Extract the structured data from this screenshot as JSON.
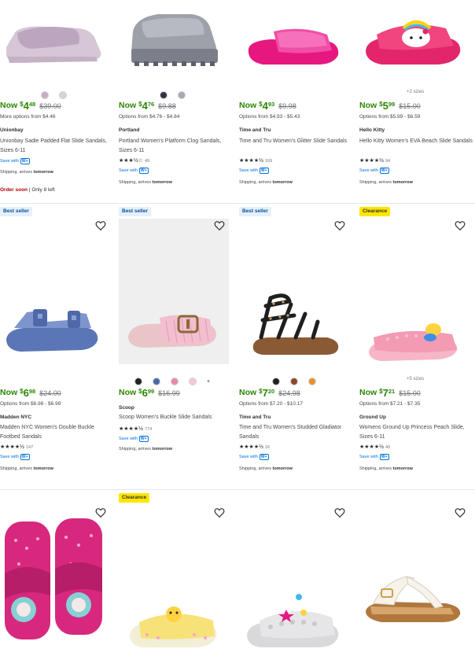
{
  "row1": [
    {
      "swatch_colors": [
        "#c9aec2",
        "#d5d5d5"
      ],
      "sizes_note": "",
      "now": "Now",
      "dollar": "$",
      "whole": "4",
      "cents": "48",
      "was": "$39.00",
      "options": "More options from $4.46",
      "brand": "Unionbay",
      "title": "Unionbay Sadie Padded Flat Slide Sandals, Sizes 6-11",
      "rating_stars": "",
      "rating_count": "",
      "save_with": "Save with",
      "wplus": "W+",
      "shipping": "Shipping, arrives",
      "shipping_day": "tomorrow",
      "urgency_red": "Order soon",
      "urgency_rest": " | Only 8 left"
    },
    {
      "swatch_colors": [
        "#2f3540",
        "#a5a9b6"
      ],
      "sizes_note": "",
      "now": "Now",
      "dollar": "$",
      "whole": "4",
      "cents": "76",
      "was": "$9.88",
      "options": "Options from $4.76 - $4.84",
      "brand": "Portland",
      "title": "Portland Women's Platform Clog Sandals, Sizes 6-11",
      "rating_stars": "★★★½☆",
      "rating_count": "49",
      "save_with": "Save with",
      "wplus": "W+",
      "shipping": "Shipping, arrives",
      "shipping_day": "tomorrow"
    },
    {
      "swatch_colors": [],
      "sizes_note": "",
      "now": "Now",
      "dollar": "$",
      "whole": "4",
      "cents": "93",
      "was": "$9.98",
      "options": "Options from $4.93 - $5.43",
      "brand": "Time and Tru",
      "title": "Time and Tru Women's Glitter Slide Sandals",
      "rating_stars": "★★★★½",
      "rating_count": "169",
      "save_with": "Save with",
      "wplus": "W+",
      "shipping": "Shipping, arrives",
      "shipping_day": "tomorrow"
    },
    {
      "swatch_colors": [],
      "sizes_note": "+2 sizes",
      "now": "Now",
      "dollar": "$",
      "whole": "5",
      "cents": "99",
      "was": "$15.00",
      "options": "Options from $5.99 - $6.59",
      "brand": "Hello Kitty",
      "title": "Hello Kitty Women's EVA Beach Slide Sandals",
      "rating_stars": "★★★★½",
      "rating_count": "94",
      "save_with": "Save with",
      "wplus": "W+",
      "shipping": "Shipping, arrives",
      "shipping_day": "tomorrow"
    }
  ],
  "row2": [
    {
      "flag": "Best seller",
      "flag_type": "best",
      "swatch_colors": [],
      "sizes_note": "",
      "now": "Now",
      "dollar": "$",
      "whole": "6",
      "cents": "98",
      "was": "$24.00",
      "options": "Options from $6.98 - $6.99",
      "brand": "Madden NYC",
      "title": "Madden NYC Women's Double Buckle Footbed Sandals",
      "rating_stars": "★★★★½",
      "rating_count": "147",
      "save_with": "Save with",
      "wplus": "W+",
      "shipping": "Shipping, arrives",
      "shipping_day": "tomorrow"
    },
    {
      "flag": "Best seller",
      "flag_type": "best",
      "swatch_colors": [
        "#222222",
        "#4a6aa5",
        "#e68aa3",
        "#f2c9d6"
      ],
      "more_swatches": "+",
      "sizes_note": "",
      "now": "Now",
      "dollar": "$",
      "whole": "6",
      "cents": "99",
      "was": "$16.99",
      "options": "",
      "brand": "Scoop",
      "title": "Scoop Women's Buckle Slide Sandals",
      "rating_stars": "★★★★½",
      "rating_count": "774",
      "save_with": "Save with",
      "wplus": "W+",
      "shipping": "Shipping, arrives",
      "shipping_day": "tomorrow"
    },
    {
      "flag": "Best seller",
      "flag_type": "best",
      "swatch_colors": [
        "#222222",
        "#8a4a2a",
        "#e8922a"
      ],
      "sizes_note": "",
      "now": "Now",
      "dollar": "$",
      "whole": "7",
      "cents": "20",
      "was": "$24.98",
      "options": "Options from $7.20 - $10.17",
      "brand": "Time and Tru",
      "title": "Time and Tru Women's Studded Gladiator Sandals",
      "rating_stars": "★★★★½",
      "rating_count": "16",
      "save_with": "Save with",
      "wplus": "W+",
      "shipping": "Shipping, arrives",
      "shipping_day": "tomorrow"
    },
    {
      "flag": "Clearance",
      "flag_type": "clear",
      "swatch_colors": [],
      "sizes_note": "+5 sizes",
      "now": "Now",
      "dollar": "$",
      "whole": "7",
      "cents": "21",
      "was": "$15.00",
      "options": "Options from $7.21 - $7.35",
      "brand": "Ground Up",
      "title": "Womens Ground Up Princess Peach Slide, Sizes 6-11",
      "rating_stars": "★★★★½",
      "rating_count": "40",
      "save_with": "Save with",
      "wplus": "W+",
      "shipping": "Shipping, arrives",
      "shipping_day": "tomorrow"
    }
  ],
  "row3": [
    {
      "flag": ""
    },
    {
      "flag": "Clearance",
      "flag_type": "clear"
    },
    {
      "flag": ""
    },
    {
      "flag": ""
    }
  ],
  "colors": {
    "price_green": "#2a8703",
    "link_blue": "#0071dc",
    "urgent_red": "#b30000"
  }
}
